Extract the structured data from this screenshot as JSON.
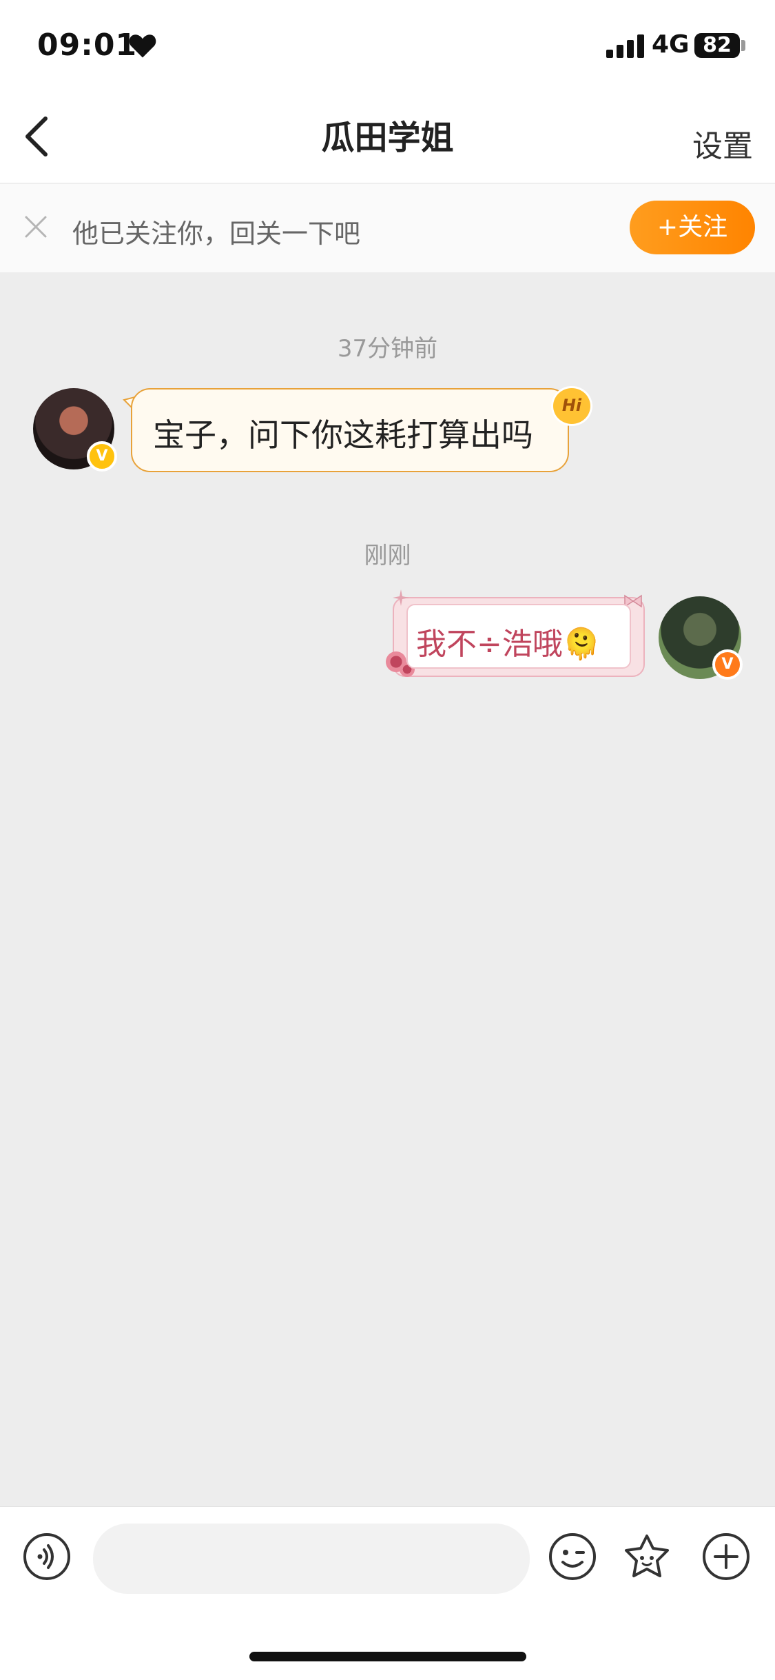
{
  "status_bar": {
    "time": "09:01",
    "network": "4G",
    "battery": "82"
  },
  "nav": {
    "title": "瓜田学姐",
    "settings_label": "设置"
  },
  "banner": {
    "text": "他已关注你，回关一下吧",
    "follow_label": "+关注"
  },
  "messages": [
    {
      "timestamp": "37分钟前",
      "side": "left",
      "text": "宝子，问下你这耗打算出吗",
      "badge": "Hi"
    },
    {
      "timestamp": "刚刚",
      "side": "right",
      "text": "我不÷浩哦🫠"
    }
  ],
  "avatar_badge": "V",
  "colors": {
    "accent_orange": "#ff8f12",
    "bubble_left_border": "#e8a23a",
    "bubble_right_text": "#c0455d",
    "chat_bg": "#ededed"
  },
  "icons": {
    "voice": "voice-icon",
    "emoji": "emoji-icon",
    "sticker": "sticker-icon",
    "add": "plus-circle-icon"
  }
}
